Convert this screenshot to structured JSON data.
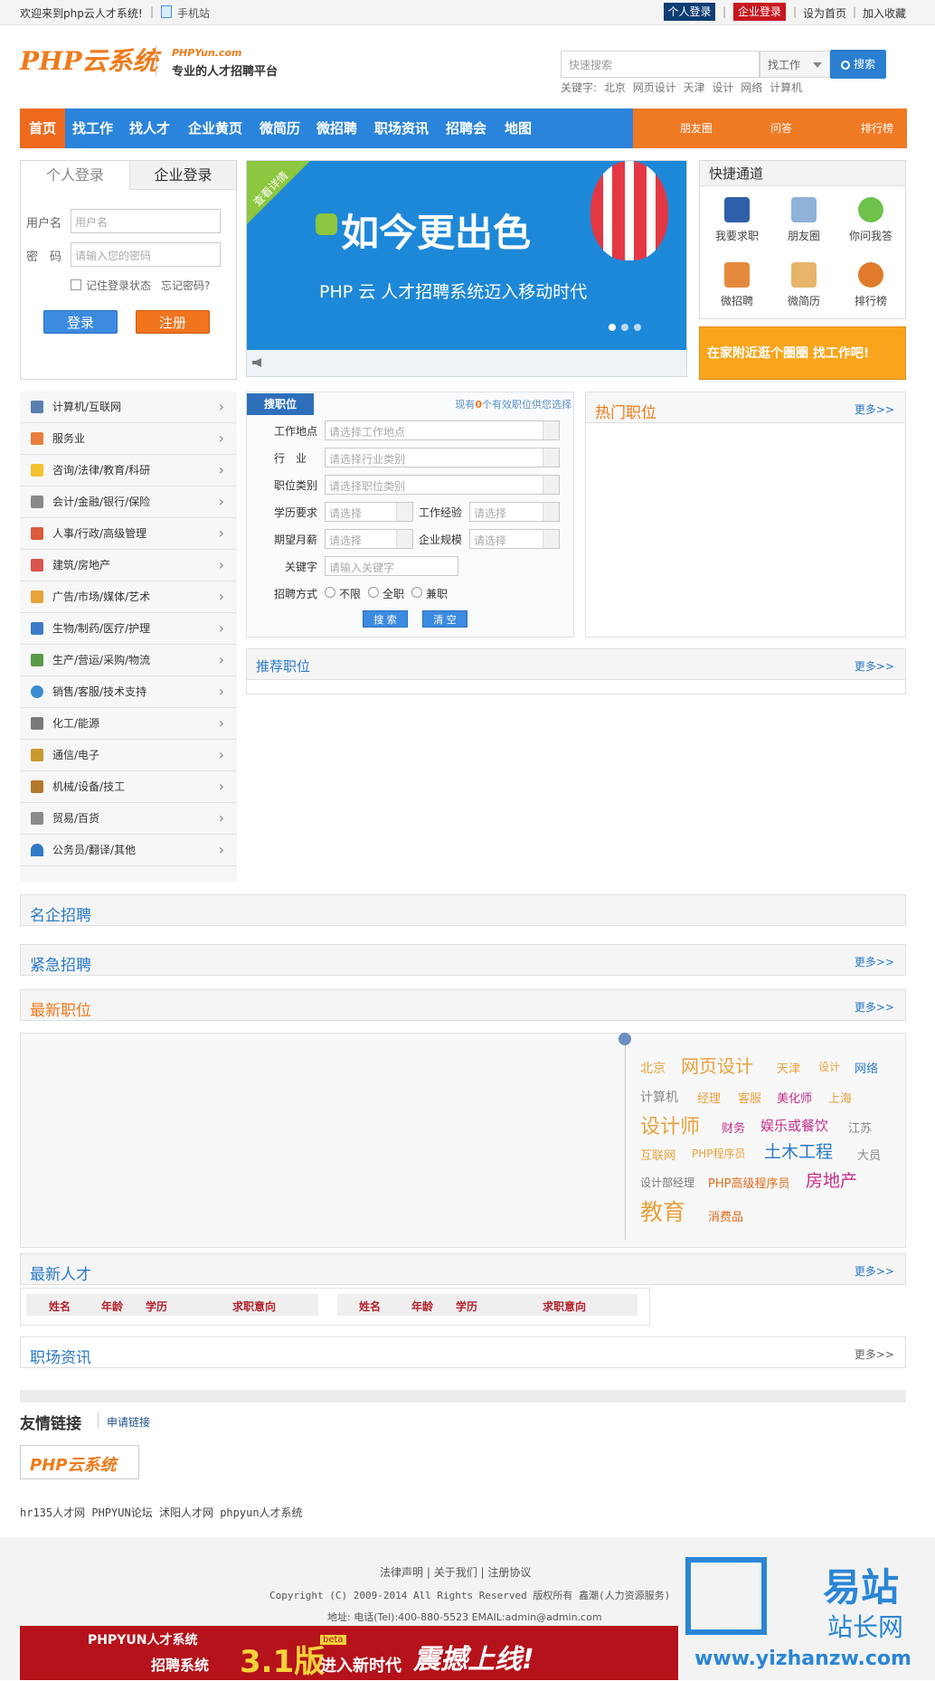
{
  "topbar": {
    "welcome": "欢迎来到php云人才系统!",
    "mobile": "手机站",
    "personal_login": "个人登录",
    "company_login": "企业登录",
    "set_home": "设为首页",
    "favorite": "加入收藏"
  },
  "header": {
    "logo_text": "PHP云系统",
    "logo_site": "PHPYun.com",
    "slogan": "专业的人才招聘平台",
    "search_placeholder": "快速搜索",
    "search_type": "找工作",
    "search_button": "搜索",
    "keywords_label": "关键字:",
    "keywords": [
      "北京",
      "网页设计",
      "天津",
      "设计",
      "网络",
      "计算机"
    ]
  },
  "nav": {
    "items": [
      "首页",
      "找工作",
      "找人才",
      "企业黄页",
      "微简历",
      "微招聘",
      "职场资讯",
      "招聘会",
      "地图"
    ],
    "right": [
      "朋友圈",
      "问答",
      "排行榜"
    ]
  },
  "login": {
    "tab_personal": "个人登录",
    "tab_company": "企业登录",
    "user_label": "用户名",
    "user_placeholder": "用户名",
    "pwd_label": "密　码",
    "pwd_placeholder": "请输入您的密码",
    "remember": "记住登录状态",
    "forgot": "忘记密码?",
    "login_btn": "登录",
    "register_btn": "注册"
  },
  "banner": {
    "ribbon": "查看详情",
    "headline": "如今更出色",
    "subline": "PHP 云 人才招聘系统迈入移动时代"
  },
  "quick": {
    "title": "快捷通道",
    "items": [
      "我要求职",
      "朋友圈",
      "你问我答",
      "微招聘",
      "微简历",
      "排行榜"
    ]
  },
  "ad1": {
    "text": "在家附近逛个圈圈 找工作吧!"
  },
  "categories": [
    "计算机/互联网",
    "服务业",
    "咨询/法律/教育/科研",
    "会计/金融/银行/保险",
    "人事/行政/高级管理",
    "建筑/房地产",
    "广告/市场/媒体/艺术",
    "生物/制药/医疗/护理",
    "生产/营运/采购/物流",
    "销售/客服/技术支持",
    "化工/能源",
    "通信/电子",
    "机械/设备/技工",
    "贸易/百货",
    "公务员/翻译/其他"
  ],
  "search_job": {
    "tab": "搜职位",
    "info_prefix": "现有",
    "info_count": "0",
    "info_suffix": "个有效职位供您选择",
    "location_label": "工作地点",
    "location_ph": "请选择工作地点",
    "industry_label": "行　业",
    "industry_ph": "请选择行业类别",
    "category_label": "职位类别",
    "category_ph": "请选择职位类别",
    "edu_label": "学历要求",
    "edu_ph": "请选择",
    "exp_label": "工作经验",
    "exp_ph": "请选择",
    "salary_label": "期望月薪",
    "salary_ph": "请选择",
    "scale_label": "企业规模",
    "scale_ph": "请选择",
    "kw_label": "关键字",
    "kw_ph": "请输入关键字",
    "mode_label": "招聘方式",
    "modes": [
      "不限",
      "全职",
      "兼职"
    ],
    "search_btn": "搜 索",
    "clear_btn": "清 空"
  },
  "hot": {
    "title": "热门职位",
    "more": "更多>>"
  },
  "recommend": {
    "title": "推荐职位",
    "more": "更多>>"
  },
  "famous": {
    "title": "名企招聘"
  },
  "urgent": {
    "title": "紧急招聘",
    "more": "更多>>"
  },
  "latest": {
    "title": "最新职位",
    "more": "更多>>"
  },
  "tags": [
    "北京",
    "网页设计",
    "天津",
    "设计",
    "网络",
    "计算机",
    "经理",
    "客服",
    "美化师",
    "上海",
    "设计师",
    "财务",
    "娱乐或餐饮",
    "江苏",
    "互联网",
    "PHP程序员",
    "土木工程",
    "大员",
    "设计部经理",
    "PHP高级程序员",
    "房地产",
    "教育",
    "消费品"
  ],
  "talent": {
    "title": "最新人才",
    "more": "更多>>",
    "cols": [
      "姓名",
      "年龄",
      "学历",
      "求职意向"
    ]
  },
  "news": {
    "title": "职场资讯",
    "more": "更多>>"
  },
  "links": {
    "title": "友情链接",
    "apply": "申请链接",
    "logo_text": "PHP云系统",
    "text_links": [
      "hr135人才网",
      "PHPYUN论坛",
      "沭阳人才网",
      "phpyun人才系统"
    ]
  },
  "footer": {
    "links": [
      "法律声明",
      "关于我们",
      "注册协议"
    ],
    "copyright": "Copyright (C) 2009-2014 All Rights Reserved 版权所有 鑫潮(人力资源服务)",
    "address": "地址: 电话(Tel):400-880-5523 EMAIL:admin@admin.com",
    "ad_brand": "PHPYUN人才系统",
    "ad_sub": "招聘系统",
    "ad_version": "3.1版",
    "ad_beta": "beta",
    "ad_new": "进入新时代",
    "ad_launch": "震撼上线!",
    "wm_big": "易站",
    "wm_small": "站长网",
    "wm_url": "www.yizhanzw.com"
  }
}
